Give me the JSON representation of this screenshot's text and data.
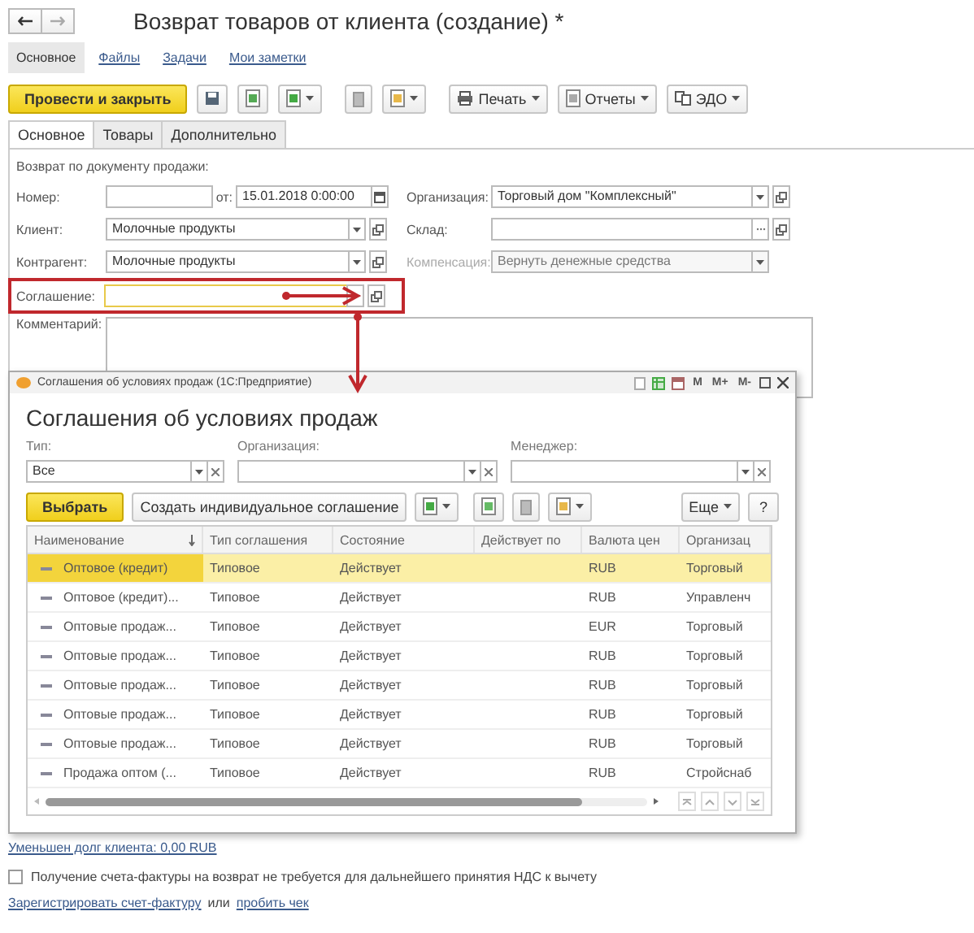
{
  "window": {
    "title": "Возврат товаров от клиента (создание) *"
  },
  "sections": [
    {
      "label": "Основное",
      "selected": true
    },
    {
      "label": "Файлы",
      "selected": false
    },
    {
      "label": "Задачи",
      "selected": false
    },
    {
      "label": "Мои заметки",
      "selected": false
    }
  ],
  "toolbar": {
    "post_button": "Провести и закрыть",
    "menus": [
      {
        "label": "Печать",
        "kind": "print"
      },
      {
        "label": "Отчеты",
        "kind": "reports"
      },
      {
        "label": "ЭДО",
        "kind": "edo"
      }
    ]
  },
  "tabs": [
    {
      "label": "Основное",
      "selected": true
    },
    {
      "label": "Товары",
      "selected": false
    },
    {
      "label": "Дополнительно",
      "selected": false
    }
  ],
  "form": {
    "group_label": "Возврат по документу продажи:",
    "number": {
      "label": "Номер:"
    },
    "date": {
      "label": "от:",
      "value": "15.01.2018  0:00:00"
    },
    "organization": {
      "label": "Организация:",
      "value": "Торговый дом \"Комплексный\""
    },
    "client": {
      "label": "Клиент:",
      "value": "Молочные продукты"
    },
    "warehouse": {
      "label": "Склад:"
    },
    "counterparty": {
      "label": "Контрагент:",
      "value": "Молочные продукты"
    },
    "compensation": {
      "label": "Компенсация:",
      "value": "Вернуть денежные средства",
      "disabled": true
    },
    "agreement": {
      "label": "Соглашение:",
      "highlighted": true
    },
    "comment": {
      "label": "Комментарий:"
    }
  },
  "dialog": {
    "window_title": "Соглашения об условиях продаж  (1С:Предприятие)",
    "title_buttons": [
      "M",
      "M+",
      "M-"
    ],
    "heading": "Соглашения об условиях продаж",
    "filters": [
      {
        "label": "Тип:",
        "value": "Все"
      },
      {
        "label": "Организация:"
      },
      {
        "label": "Менеджер:"
      }
    ],
    "select_button": "Выбрать",
    "create_button": "Создать индивидуальное соглашение",
    "more_button": "Еще",
    "help_button": "?",
    "table": {
      "columns": [
        "Наименование",
        "Тип соглашения",
        "Состояние",
        "Действует по",
        "Валюта цен",
        "Организац"
      ],
      "rows": [
        {
          "cells": [
            "Оптовое (кредит)",
            "Типовое",
            "Действует",
            "",
            "RUB",
            "Торговый"
          ],
          "selected": true
        },
        {
          "cells": [
            "Оптовое (кредит)...",
            "Типовое",
            "Действует",
            "",
            "RUB",
            "Управленч"
          ],
          "selected": false
        },
        {
          "cells": [
            "Оптовые продаж...",
            "Типовое",
            "Действует",
            "",
            "EUR",
            "Торговый"
          ],
          "selected": false
        },
        {
          "cells": [
            "Оптовые продаж...",
            "Типовое",
            "Действует",
            "",
            "RUB",
            "Торговый"
          ],
          "selected": false
        },
        {
          "cells": [
            "Оптовые продаж...",
            "Типовое",
            "Действует",
            "",
            "RUB",
            "Торговый"
          ],
          "selected": false
        },
        {
          "cells": [
            "Оптовые продаж...",
            "Типовое",
            "Действует",
            "",
            "RUB",
            "Торговый"
          ],
          "selected": false
        },
        {
          "cells": [
            "Оптовые продаж...",
            "Типовое",
            "Действует",
            "",
            "RUB",
            "Торговый"
          ],
          "selected": false
        },
        {
          "cells": [
            "Продажа оптом (...",
            "Типовое",
            "Действует",
            "",
            "RUB",
            "Стройснаб"
          ],
          "selected": false
        }
      ]
    }
  },
  "footer": {
    "debt_link": "Уменьшен долг клиента: 0,00 RUB",
    "invoice_checkbox": {
      "label": "Получение счета-фактуры на возврат не требуется для дальнейшего принятия НДС к вычету",
      "checked": false
    },
    "register_link": "Зарегистрировать счет-фактуру",
    "or_text": "или",
    "receipt_link": "пробить чек"
  }
}
